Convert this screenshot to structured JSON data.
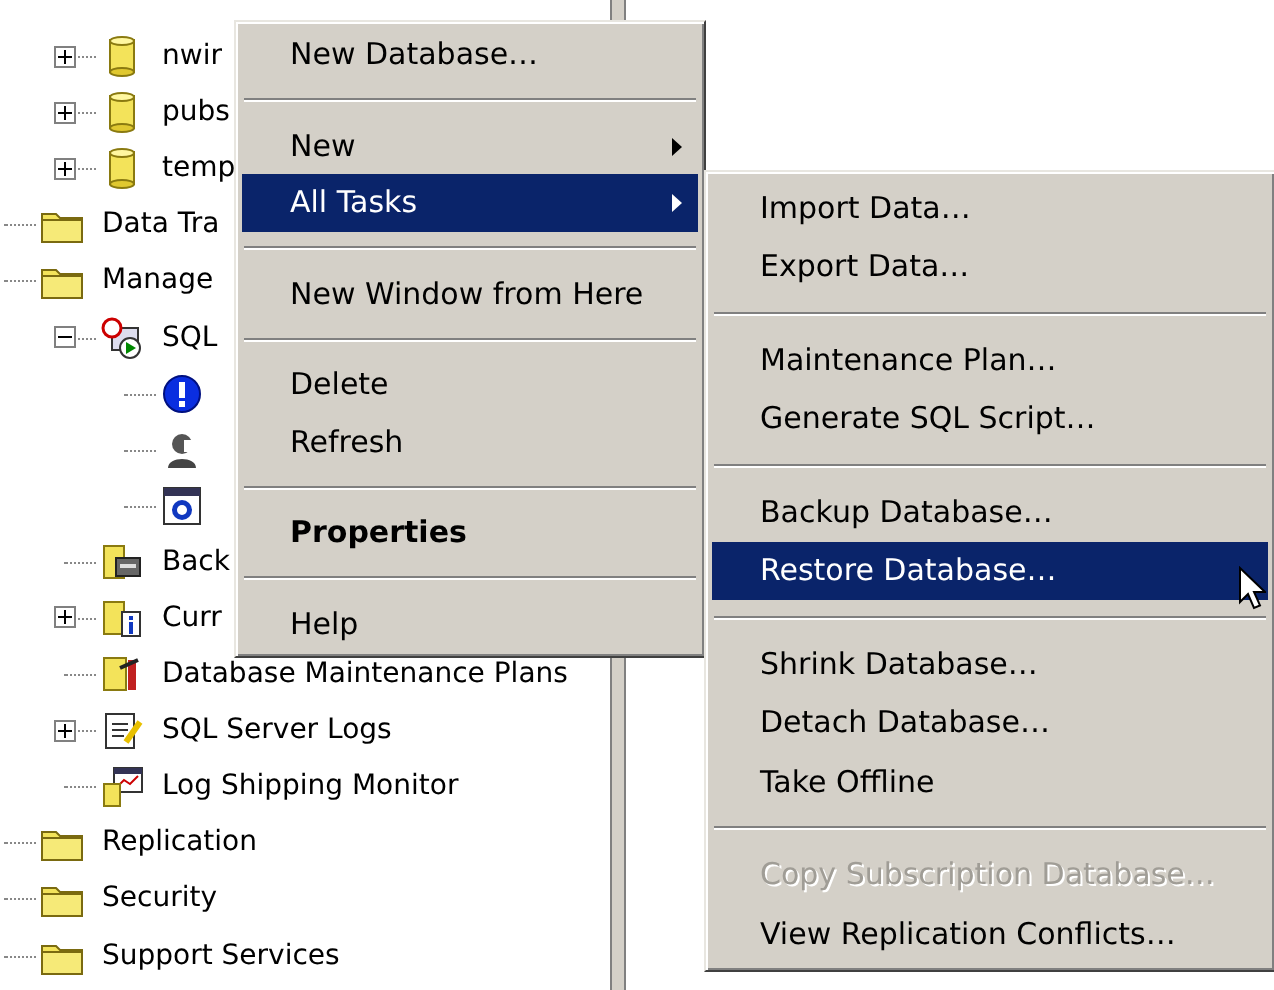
{
  "tree": [
    {
      "children": [
        {
          "label": "nwir",
          "kind": "database",
          "expanded": false
        },
        {
          "label": "pubs",
          "kind": "database",
          "expanded": false
        },
        {
          "label": "temp",
          "kind": "database",
          "expanded": false
        }
      ]
    },
    {
      "label": "Data Tra",
      "kind": "folder"
    },
    {
      "label": "Manage",
      "kind": "folder",
      "children": [
        {
          "label": "SQL",
          "kind": "agent",
          "expanded": true,
          "children": [
            {
              "kind": "alert"
            },
            {
              "kind": "operator"
            },
            {
              "kind": "job"
            }
          ]
        },
        {
          "label": "Back",
          "kind": "backup"
        },
        {
          "label": "Curr",
          "kind": "activity",
          "expanded": false
        },
        {
          "label": "Database Maintenance Plans",
          "kind": "plans"
        },
        {
          "label": "SQL Server Logs",
          "kind": "logs",
          "expanded": false
        },
        {
          "label": "Log Shipping Monitor",
          "kind": "monitor"
        }
      ]
    },
    {
      "label": "Replication",
      "kind": "folder"
    },
    {
      "label": "Security",
      "kind": "folder"
    },
    {
      "label": "Support Services",
      "kind": "folder"
    }
  ],
  "context_menu": {
    "items": [
      {
        "kind": "item",
        "label": "New Database…",
        "selected": false,
        "disabled": false,
        "default": false,
        "submenu": false
      },
      {
        "kind": "separator"
      },
      {
        "kind": "item",
        "label": "New",
        "selected": false,
        "disabled": false,
        "default": false,
        "submenu": true
      },
      {
        "kind": "item",
        "label": "All Tasks",
        "selected": true,
        "disabled": false,
        "default": false,
        "submenu": true
      },
      {
        "kind": "separator"
      },
      {
        "kind": "item",
        "label": "New Window from Here",
        "selected": false,
        "disabled": false,
        "default": false,
        "submenu": false
      },
      {
        "kind": "separator"
      },
      {
        "kind": "item",
        "label": "Delete",
        "selected": false,
        "disabled": false,
        "default": false,
        "submenu": false
      },
      {
        "kind": "item",
        "label": "Refresh",
        "selected": false,
        "disabled": false,
        "default": false,
        "submenu": false
      },
      {
        "kind": "separator"
      },
      {
        "kind": "item",
        "label": "Properties",
        "selected": false,
        "disabled": false,
        "default": true,
        "submenu": false
      },
      {
        "kind": "separator"
      },
      {
        "kind": "item",
        "label": "Help",
        "selected": false,
        "disabled": false,
        "default": false,
        "submenu": false
      }
    ]
  },
  "submenu": {
    "items": [
      {
        "kind": "item",
        "label": "Import Data…",
        "selected": false,
        "disabled": false,
        "default": false,
        "submenu": false
      },
      {
        "kind": "item",
        "label": "Export Data…",
        "selected": false,
        "disabled": false,
        "default": false,
        "submenu": false
      },
      {
        "kind": "separator"
      },
      {
        "kind": "item",
        "label": "Maintenance Plan…",
        "selected": false,
        "disabled": false,
        "default": false,
        "submenu": false
      },
      {
        "kind": "item",
        "label": "Generate SQL Script…",
        "selected": false,
        "disabled": false,
        "default": false,
        "submenu": false
      },
      {
        "kind": "separator"
      },
      {
        "kind": "item",
        "label": "Backup Database…",
        "selected": false,
        "disabled": false,
        "default": false,
        "submenu": false
      },
      {
        "kind": "item",
        "label": "Restore Database…",
        "selected": true,
        "disabled": false,
        "default": false,
        "submenu": false
      },
      {
        "kind": "separator"
      },
      {
        "kind": "item",
        "label": "Shrink Database…",
        "selected": false,
        "disabled": false,
        "default": false,
        "submenu": false
      },
      {
        "kind": "item",
        "label": "Detach Database…",
        "selected": false,
        "disabled": false,
        "default": false,
        "submenu": false
      },
      {
        "kind": "item",
        "label": "Take Offline",
        "selected": false,
        "disabled": false,
        "default": false,
        "submenu": false
      },
      {
        "kind": "separator"
      },
      {
        "kind": "item",
        "label": "Copy Subscription Database…",
        "selected": false,
        "disabled": true,
        "default": false,
        "submenu": false
      },
      {
        "kind": "item",
        "label": "View Replication Conflicts…",
        "selected": false,
        "disabled": false,
        "default": false,
        "submenu": false
      }
    ]
  }
}
